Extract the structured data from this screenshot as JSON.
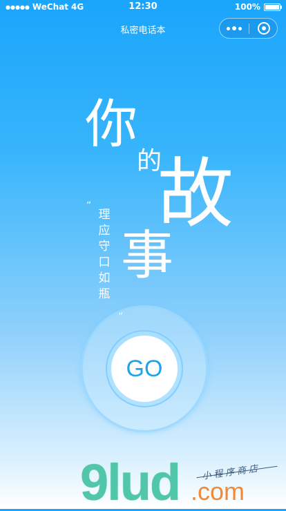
{
  "status_bar": {
    "signal": "●●●●●",
    "carrier": "WeChat",
    "network": "4G",
    "time": "12:30",
    "battery": "100%"
  },
  "nav": {
    "title": "私密电话本"
  },
  "hero": {
    "char_ni": "你",
    "char_de": "的",
    "char_gu": "故",
    "char_shi": "事",
    "quote_chars": [
      "理",
      "应",
      "守",
      "口",
      "如",
      "瓶"
    ],
    "quote_open": "“",
    "quote_close": "”"
  },
  "go_button": {
    "label": "GO"
  },
  "watermark": {
    "logo": "9lud",
    "suffix": ".com",
    "tagline": "小程序商店"
  },
  "colors": {
    "accent": "#1ea3ee",
    "top_gradient": "#1aa5fb",
    "bottom_gradient": "#ffffff"
  }
}
